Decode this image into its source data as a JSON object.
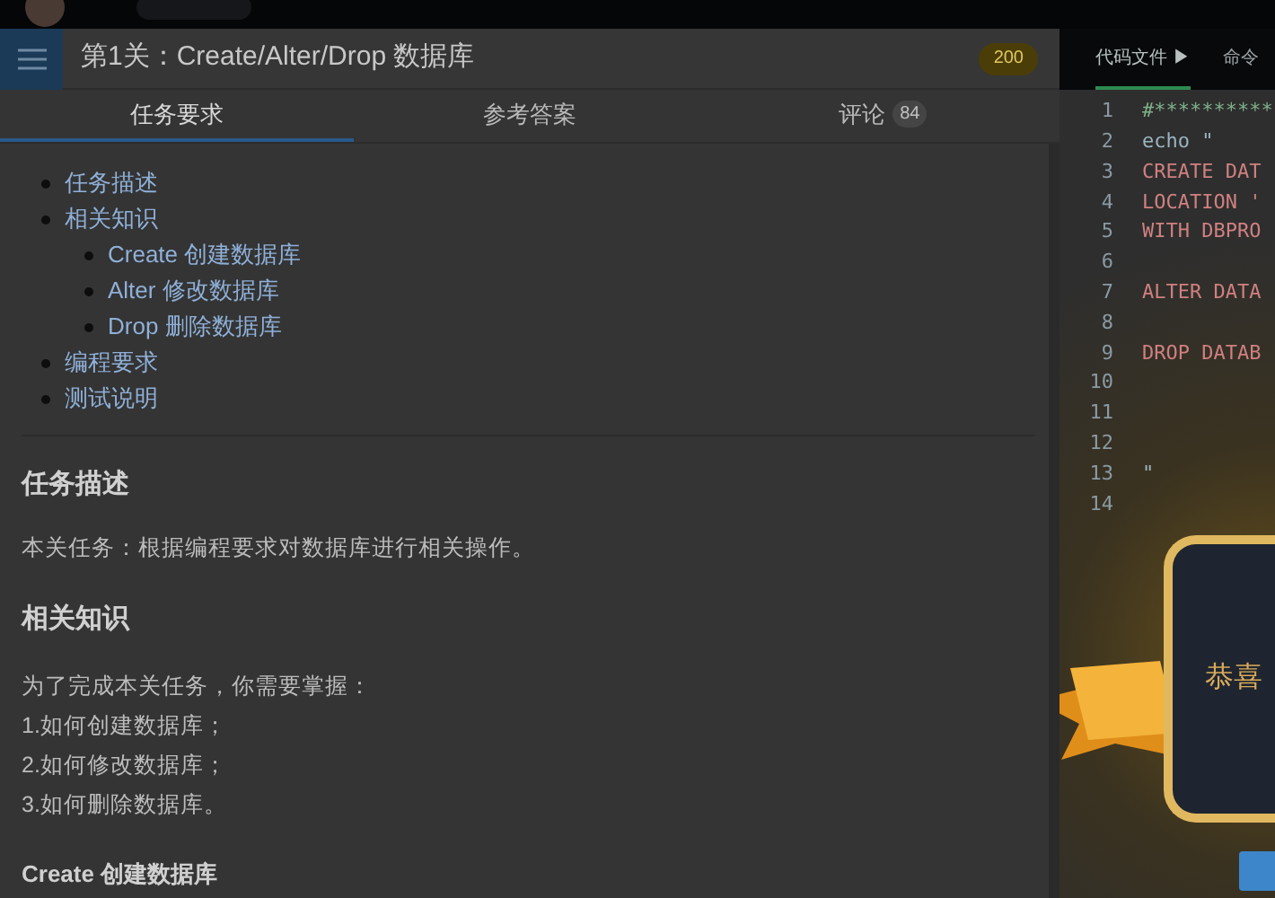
{
  "header": {
    "title": "第1关：Create/Alter/Drop 数据库",
    "score": "200"
  },
  "tabs": [
    {
      "label": "任务要求",
      "selected": true
    },
    {
      "label": "参考答案",
      "selected": false
    },
    {
      "label": "评论",
      "count": "84",
      "selected": false
    }
  ],
  "toc": [
    {
      "label": "任务描述"
    },
    {
      "label": "相关知识",
      "children": [
        {
          "label": "Create 创建数据库"
        },
        {
          "label": "Alter 修改数据库"
        },
        {
          "label": "Drop 删除数据库"
        }
      ]
    },
    {
      "label": "编程要求"
    },
    {
      "label": "测试说明"
    }
  ],
  "content": [
    {
      "kind": "heading",
      "text": "任务描述"
    },
    {
      "kind": "para",
      "text": "本关任务：根据编程要求对数据库进行相关操作。"
    },
    {
      "kind": "heading",
      "text": "相关知识"
    },
    {
      "kind": "lines",
      "lines": [
        "为了完成本关任务，你需要掌握：",
        "1.如何创建数据库；",
        "2.如何修改数据库；",
        "3.如何删除数据库。"
      ]
    },
    {
      "kind": "subheading",
      "text": "Create 创建数据库"
    }
  ],
  "editor": {
    "tabs": [
      {
        "label": "代码文件 ▶",
        "selected": true
      },
      {
        "label": "命令",
        "selected": false
      }
    ],
    "lines": [
      {
        "no": "1",
        "text": "#**********",
        "kind": "comment"
      },
      {
        "no": "2",
        "text": "echo \"",
        "kind": "plain"
      },
      {
        "no": "3",
        "text": "CREATE DAT",
        "kind": "keyword"
      },
      {
        "no": "4",
        "text": "LOCATION '",
        "kind": "keyword"
      },
      {
        "no": "5",
        "text": "WITH DBPRO",
        "kind": "keyword"
      },
      {
        "no": "6"
      },
      {
        "no": "7",
        "text": "ALTER DATA",
        "kind": "keyword"
      },
      {
        "no": "8"
      },
      {
        "no": "9",
        "text": "DROP DATAB",
        "kind": "keyword"
      },
      {
        "no": "10"
      },
      {
        "no": "11"
      },
      {
        "no": "12"
      },
      {
        "no": "13",
        "text": "\"",
        "kind": "plain"
      },
      {
        "no": "14"
      }
    ]
  },
  "award": {
    "text": "恭喜"
  }
}
